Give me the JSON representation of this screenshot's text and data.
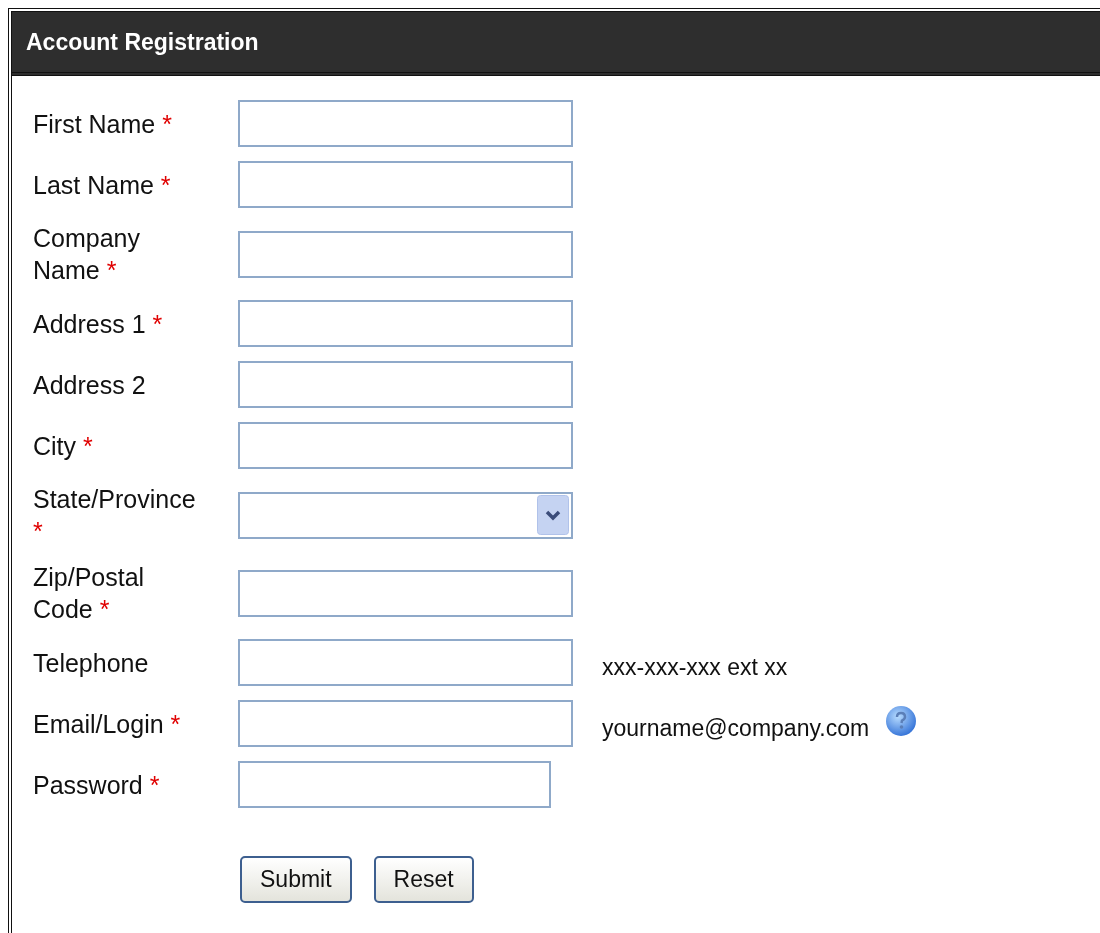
{
  "window": {
    "title": "Account Registration"
  },
  "fields": [
    {
      "label": "First Name",
      "required": true,
      "required_mark": "*",
      "kind": "text"
    },
    {
      "label": "Last Name",
      "required": true,
      "required_mark": "*",
      "kind": "text"
    },
    {
      "label": "Company Name",
      "required": true,
      "required_mark": "*",
      "kind": "text"
    },
    {
      "label": "Address 1",
      "required": true,
      "required_mark": "*",
      "kind": "text"
    },
    {
      "label": "Address 2",
      "kind": "text"
    },
    {
      "label": "City",
      "required": true,
      "required_mark": "*",
      "kind": "text"
    },
    {
      "label": "State/Province",
      "required": true,
      "required_mark": "*",
      "kind": "select"
    },
    {
      "label": "Zip/Postal Code",
      "required": true,
      "required_mark": "*",
      "kind": "text"
    },
    {
      "label": "Telephone",
      "kind": "text",
      "hint": "xxx-xxx-xxx ext xx"
    },
    {
      "label": "Email/Login",
      "required": true,
      "required_mark": "*",
      "kind": "text",
      "hint": "yourname@company.com",
      "help": true
    },
    {
      "label": "Password",
      "required": true,
      "required_mark": "*",
      "kind": "password"
    }
  ],
  "buttons": [
    "Submit",
    "Reset"
  ]
}
